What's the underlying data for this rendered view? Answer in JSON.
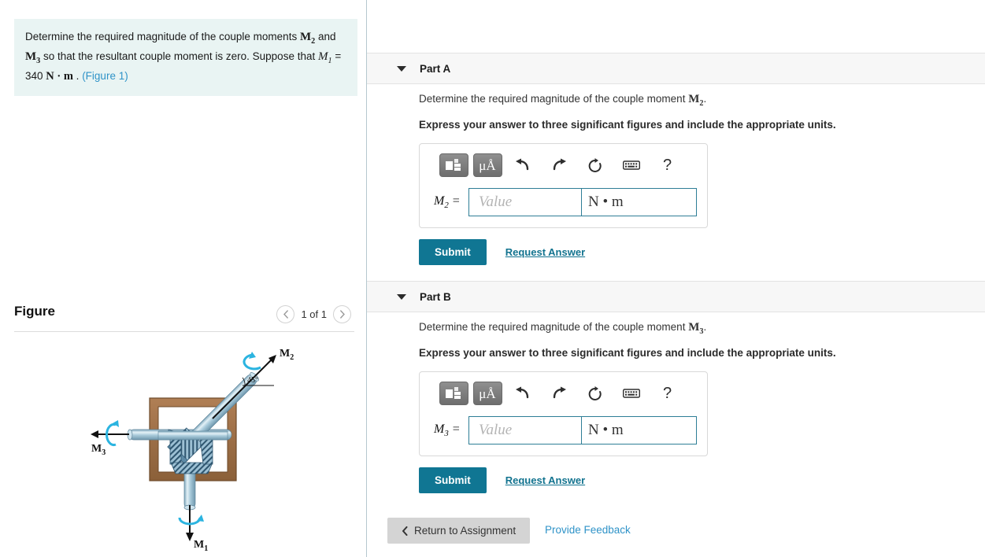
{
  "problem": {
    "text_part1": "Determine the required magnitude of the couple moments ",
    "m2": "M",
    "m2_sub": "2",
    "text_and": " and ",
    "m3": "M",
    "m3_sub": "3",
    "text_part2": " so that the resultant couple moment is zero. Suppose that ",
    "m1": "M",
    "m1_sub": "1",
    "equals": " = 340 ",
    "units": "N · m",
    "period": " . ",
    "figure_link": "(Figure 1)"
  },
  "figure": {
    "title": "Figure",
    "count": "1 of 1",
    "prev_icon": "chevron-left-icon",
    "next_icon": "chevron-right-icon",
    "labels": {
      "m1": "M",
      "m1_sub": "1",
      "m2": "M",
      "m2_sub": "2",
      "m3": "M",
      "m3_sub": "3",
      "angle": "45°"
    },
    "colors": {
      "frame": "#a2734b",
      "shaft": "#9dc3d4",
      "shaft_light": "#d9eaf2",
      "curl": "#2bb4e0",
      "gear": "#5b86a8"
    }
  },
  "parts": [
    {
      "id": "a",
      "header": "Part A",
      "caret_icon": "caret-down-icon",
      "question_prefix": "Determine the required magnitude of the couple moment ",
      "question_symbol": "M",
      "question_symbol_sub": "2",
      "question_suffix": ".",
      "instruction": "Express your answer to three significant figures and include the appropriate units.",
      "var_label": "M",
      "var_sub": "2",
      "equals": " =",
      "value": "",
      "placeholder": "Value",
      "units": "N • m",
      "submit_label": "Submit",
      "request_answer_label": "Request Answer",
      "toolbar": {
        "template_icon": "math-template-icon",
        "units_icon": "micro-angstrom-units-icon",
        "units_text": "μÅ",
        "undo_icon": "undo-arrow-icon",
        "redo_icon": "redo-arrow-icon",
        "reset_icon": "reset-circular-arrow-icon",
        "keyboard_icon": "keyboard-icon",
        "help_icon": "question-mark-icon",
        "help_text": "?"
      }
    },
    {
      "id": "b",
      "header": "Part B",
      "caret_icon": "caret-down-icon",
      "question_prefix": "Determine the required magnitude of the couple moment ",
      "question_symbol": "M",
      "question_symbol_sub": "3",
      "question_suffix": ".",
      "instruction": "Express your answer to three significant figures and include the appropriate units.",
      "var_label": "M",
      "var_sub": "3",
      "equals": " =",
      "value": "",
      "placeholder": "Value",
      "units": "N • m",
      "submit_label": "Submit",
      "request_answer_label": "Request Answer",
      "toolbar": {
        "template_icon": "math-template-icon",
        "units_icon": "micro-angstrom-units-icon",
        "units_text": "μÅ",
        "undo_icon": "undo-arrow-icon",
        "redo_icon": "redo-arrow-icon",
        "reset_icon": "reset-circular-arrow-icon",
        "keyboard_icon": "keyboard-icon",
        "help_icon": "question-mark-icon",
        "help_text": "?"
      }
    }
  ],
  "footer": {
    "return_label": "Return to Assignment",
    "return_icon": "chevron-left-icon",
    "feedback_label": "Provide Feedback"
  },
  "colors": {
    "accent_teal": "#107693",
    "link_blue": "#2f93c8",
    "panel_mint": "#e9f4f3",
    "header_grey": "#f7f7f7"
  }
}
